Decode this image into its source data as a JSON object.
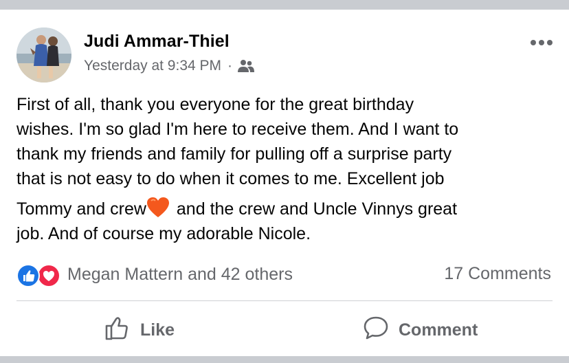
{
  "post": {
    "author": "Judi Ammar-Thiel",
    "timestamp": "Yesterday at 9:34 PM",
    "separator": "·",
    "audience_icon": "friends-icon",
    "more_icon": "more-options-icon",
    "text_lines": [
      "First of all, thank you everyone for the great birthday",
      "wishes. I'm so glad I'm here to receive them. And  I want to",
      "thank my friends and family for pulling off a surprise party",
      "that is not easy to do when it comes to me. Excellent job",
      "Tommy and crew",
      "and the crew and Uncle Vinnys great",
      "job. And of course my adorable Nicole."
    ],
    "emoji": "orange-heart"
  },
  "reactions": {
    "icons": [
      "like-reaction-icon",
      "love-reaction-icon"
    ],
    "summary": "Megan Mattern and 42 others",
    "comments": "17 Comments"
  },
  "actions": {
    "like_label": "Like",
    "comment_label": "Comment"
  },
  "colors": {
    "like_blue": "#1b74e4",
    "love_red": "#f0284a",
    "secondary_text": "#65676b",
    "primary_text": "#050505"
  }
}
